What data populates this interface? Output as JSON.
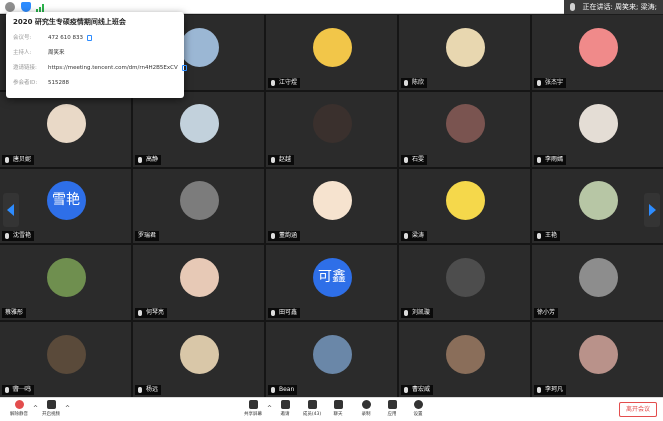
{
  "topbar": {
    "speaking_label": "正在讲话: 周笑来; 梁涛;",
    "icons": [
      "info-icon",
      "shield-icon",
      "signal-icon"
    ]
  },
  "meeting_info": {
    "title": "2020 研究生专硕疫情期间线上班会",
    "meeting_id_label": "会议号:",
    "meeting_id": "472 610 833",
    "host_label": "主持人:",
    "host": "周笑来",
    "invite_label": "邀请链接:",
    "invite_link": "https://meeting.tencent.com/dm/rn4H2B5ExCV",
    "participant_id_label": "参会者ID:",
    "participant_id": "515288"
  },
  "participants": [
    {
      "name": "",
      "avatar_text": "",
      "avatar_color": "#c9a882",
      "mic": "none"
    },
    {
      "name": "",
      "avatar_text": "",
      "avatar_color": "#9bb7d4",
      "mic": "none"
    },
    {
      "name": "江守煜",
      "avatar_text": "",
      "avatar_color": "#f2c649",
      "mic": "on"
    },
    {
      "name": "陈欣",
      "avatar_text": "",
      "avatar_color": "#e8d7b0",
      "mic": "on"
    },
    {
      "name": "张杰宇",
      "avatar_text": "",
      "avatar_color": "#f08a8a",
      "mic": "on"
    },
    {
      "name": "唐贝妮",
      "avatar_text": "",
      "avatar_color": "#e9d9c7",
      "mic": "on"
    },
    {
      "name": "高静",
      "avatar_text": "",
      "avatar_color": "#c2d1dc",
      "mic": "on"
    },
    {
      "name": "赵越",
      "avatar_text": "",
      "avatar_color": "#3a302d",
      "mic": "on"
    },
    {
      "name": "石雯",
      "avatar_text": "",
      "avatar_color": "#7a5450",
      "mic": "on"
    },
    {
      "name": "李雨嫣",
      "avatar_text": "",
      "avatar_color": "#e4ddd5",
      "mic": "on"
    },
    {
      "name": "沈雪艳",
      "avatar_text": "雪艳",
      "avatar_color": "#2e6fe8",
      "mic": "on"
    },
    {
      "name": "罗瑞君",
      "avatar_text": "",
      "avatar_color": "#7c7c7c",
      "mic": "none"
    },
    {
      "name": "董韵涵",
      "avatar_text": "",
      "avatar_color": "#f6e3cf",
      "mic": "on"
    },
    {
      "name": "梁涛",
      "avatar_text": "",
      "avatar_color": "#f5d84b",
      "mic": "on"
    },
    {
      "name": "王艳",
      "avatar_text": "",
      "avatar_color": "#b7c6a5",
      "mic": "on"
    },
    {
      "name": "蔡雅彤",
      "avatar_text": "",
      "avatar_color": "#6f8f4f",
      "mic": "none"
    },
    {
      "name": "何琴亮",
      "avatar_text": "",
      "avatar_color": "#e7c9b6",
      "mic": "on"
    },
    {
      "name": "田可鑫",
      "avatar_text": "可鑫",
      "avatar_color": "#2e6fe8",
      "mic": "on"
    },
    {
      "name": "刘凯璇",
      "avatar_text": "",
      "avatar_color": "#4d4d4d",
      "mic": "on"
    },
    {
      "name": "徐小芳",
      "avatar_text": "",
      "avatar_color": "#8d8d8d",
      "mic": "none"
    },
    {
      "name": "曹一鸣",
      "avatar_text": "",
      "avatar_color": "#5a4a3a",
      "mic": "on"
    },
    {
      "name": "杨远",
      "avatar_text": "",
      "avatar_color": "#d9c7a8",
      "mic": "on"
    },
    {
      "name": "Bean",
      "avatar_text": "",
      "avatar_color": "#6a87a8",
      "mic": "on"
    },
    {
      "name": "曹宏威",
      "avatar_text": "",
      "avatar_color": "#8a6e5a",
      "mic": "on"
    },
    {
      "name": "李珂凡",
      "avatar_text": "",
      "avatar_color": "#b9928a",
      "mic": "on"
    }
  ],
  "typing_overlay": "曹一鸣",
  "toolbar": {
    "mute_label": "解除静音",
    "video_label": "开启视频",
    "share_label": "共享屏幕",
    "invite_label": "邀请",
    "members_label": "成员(43)",
    "chat_label": "聊天",
    "record_label": "录制",
    "apps_label": "应用",
    "settings_label": "设置",
    "leave_label": "离开会议"
  },
  "colors": {
    "accent": "#2d8cff",
    "danger": "#e34d4d",
    "tile_bg": "#2b2b2b"
  }
}
